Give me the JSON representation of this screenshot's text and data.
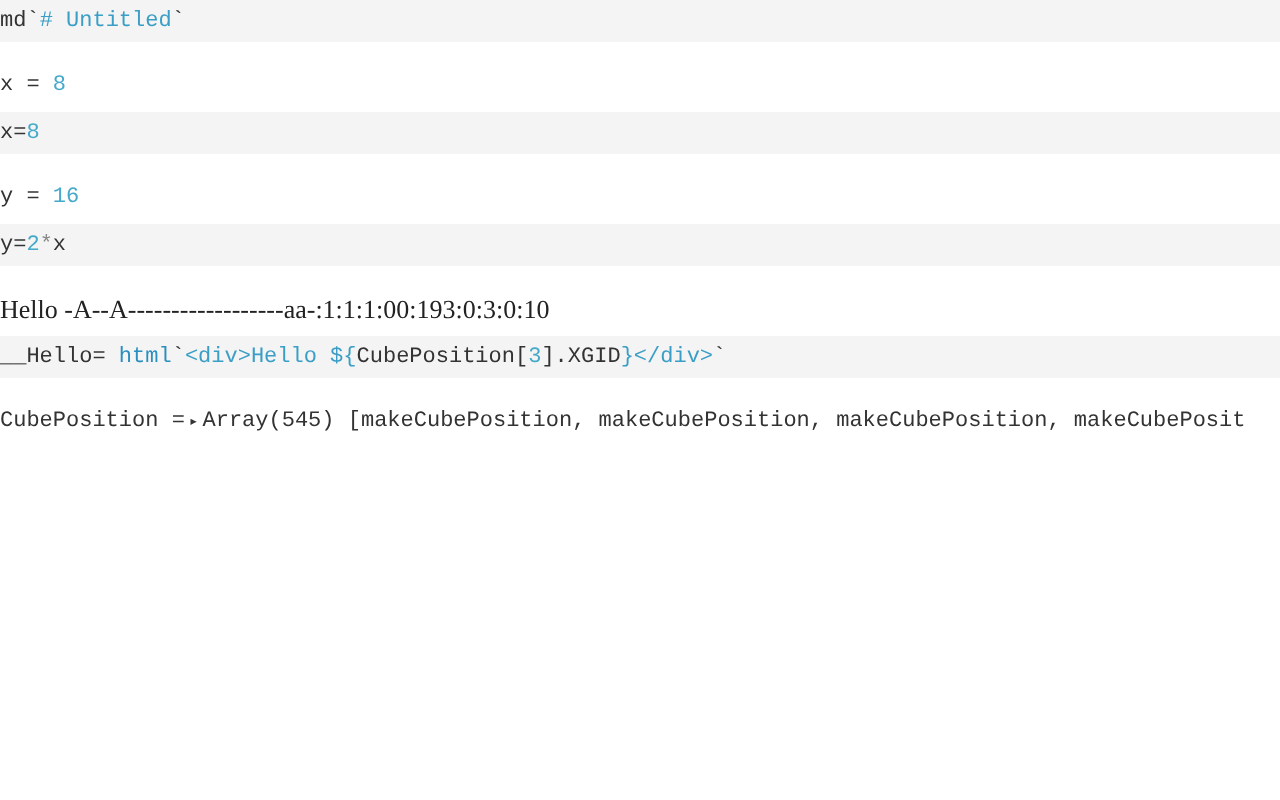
{
  "cells": [
    {
      "source": [
        {
          "kind": "plain",
          "text": "md`"
        },
        {
          "kind": "string",
          "text": "# Untitled"
        },
        {
          "kind": "plain",
          "text": "`"
        }
      ]
    },
    {
      "output": {
        "kind": "inspector",
        "parts": [
          {
            "kind": "plain",
            "text": "x = "
          },
          {
            "kind": "number",
            "text": "8"
          }
        ]
      },
      "source": [
        {
          "kind": "plain",
          "text": "x="
        },
        {
          "kind": "number",
          "text": "8"
        }
      ]
    },
    {
      "output": {
        "kind": "inspector",
        "parts": [
          {
            "kind": "plain",
            "text": "y = "
          },
          {
            "kind": "number",
            "text": "16"
          }
        ]
      },
      "source": [
        {
          "kind": "plain",
          "text": "y="
        },
        {
          "kind": "number",
          "text": "2"
        },
        {
          "kind": "op",
          "text": "*"
        },
        {
          "kind": "plain",
          "text": "x"
        }
      ]
    },
    {
      "output": {
        "kind": "html",
        "text": "Hello -A--A------------------aa-:1:1:1:00:193:0:3:0:10"
      },
      "source": [
        {
          "kind": "plain",
          "text": "__Hello= "
        },
        {
          "kind": "keyword",
          "text": "html"
        },
        {
          "kind": "plain",
          "text": "`"
        },
        {
          "kind": "string",
          "text": "<div>Hello ${"
        },
        {
          "kind": "plain",
          "text": "CubePosition["
        },
        {
          "kind": "number",
          "text": "3"
        },
        {
          "kind": "plain",
          "text": "].XGID"
        },
        {
          "kind": "string",
          "text": "}</div>"
        },
        {
          "kind": "plain",
          "text": "`"
        }
      ]
    },
    {
      "output": {
        "kind": "inspector",
        "parts": [
          {
            "kind": "plain",
            "text": "CubePosition = "
          },
          {
            "kind": "toggle",
            "text": "▸"
          },
          {
            "kind": "plain",
            "text": " Array(545) [makeCubePosition, makeCubePosition, makeCubePosition, makeCubePosit"
          }
        ]
      }
    }
  ]
}
